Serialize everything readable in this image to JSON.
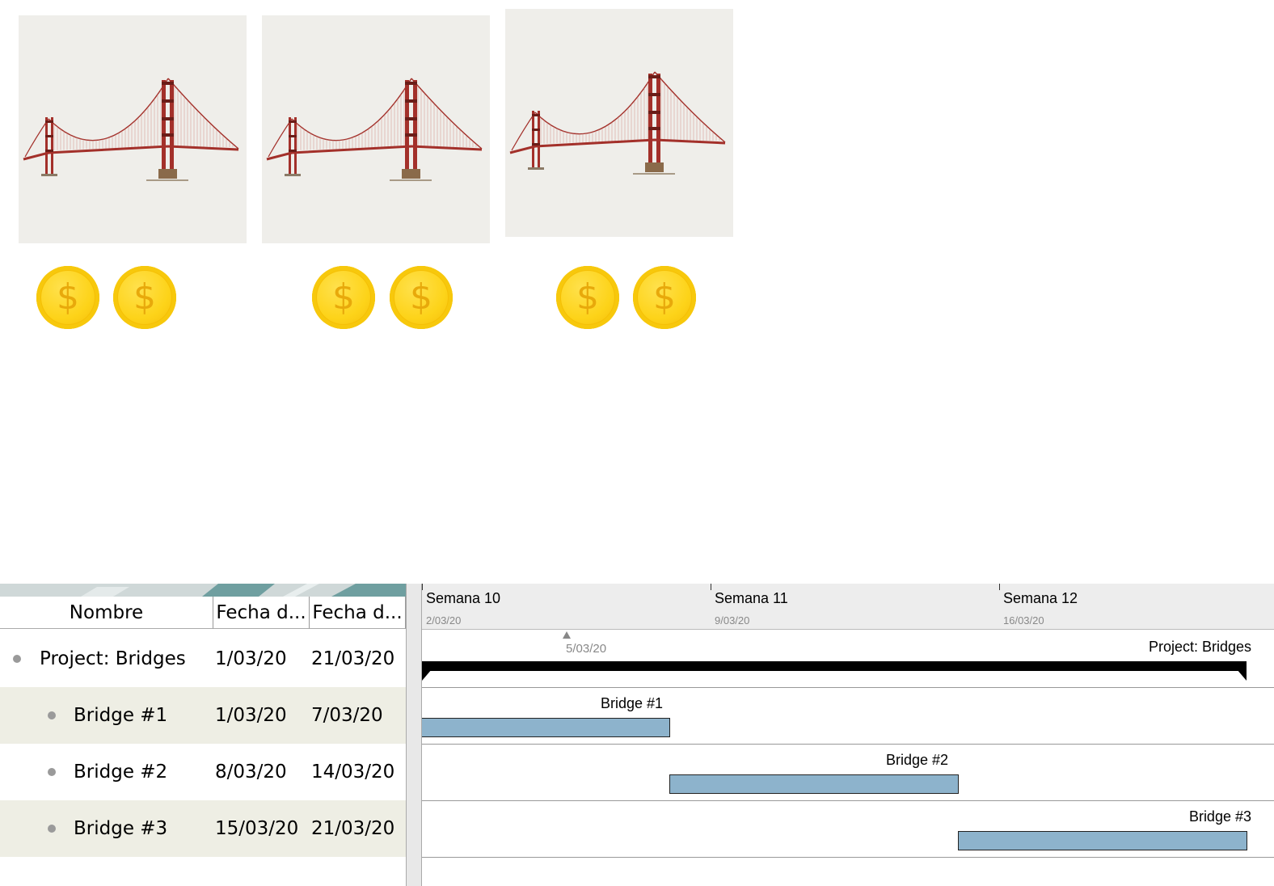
{
  "colors": {
    "card_bg": "#efeeea",
    "coin": "#fdd319",
    "task_bar": "#8db3cc",
    "alt_row": "#eeeee4"
  },
  "bridges": [
    {
      "icon": "golden-gate-bridge"
    },
    {
      "icon": "golden-gate-bridge"
    },
    {
      "icon": "golden-gate-bridge"
    }
  ],
  "coins": [
    {
      "symbol": "$"
    },
    {
      "symbol": "$"
    },
    {
      "symbol": "$"
    },
    {
      "symbol": "$"
    },
    {
      "symbol": "$"
    },
    {
      "symbol": "$"
    }
  ],
  "table": {
    "headers": [
      "Nombre",
      "Fecha d...",
      "Fecha d..."
    ],
    "rows": [
      {
        "name": "Project: Bridges",
        "start": "1/03/20",
        "end": "21/03/20"
      },
      {
        "name": "Bridge #1",
        "start": "1/03/20",
        "end": "7/03/20"
      },
      {
        "name": "Bridge #2",
        "start": "8/03/20",
        "end": "14/03/20"
      },
      {
        "name": "Bridge #3",
        "start": "15/03/20",
        "end": "21/03/20"
      }
    ]
  },
  "timescale": {
    "weeks": [
      {
        "label": "Semana 10",
        "date": "2/03/20"
      },
      {
        "label": "Semana 11",
        "date": "9/03/20"
      },
      {
        "label": "Semana 12",
        "date": "16/03/20"
      }
    ],
    "marker": "5/03/20"
  },
  "bars": [
    {
      "label": "Project: Bridges",
      "start": "2020-03-01",
      "end": "2020-03-21"
    },
    {
      "label": "Bridge #1",
      "start": "2020-03-01",
      "end": "2020-03-07"
    },
    {
      "label": "Bridge #2",
      "start": "2020-03-08",
      "end": "2020-03-14"
    },
    {
      "label": "Bridge #3",
      "start": "2020-03-15",
      "end": "2020-03-21"
    }
  ]
}
